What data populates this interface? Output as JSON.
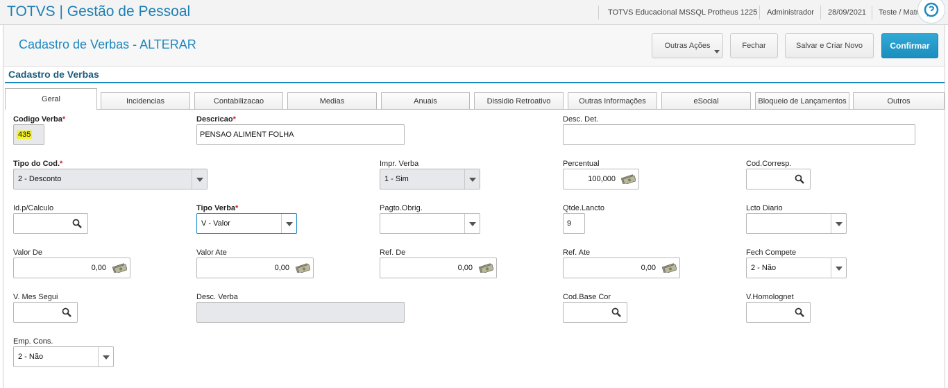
{
  "header": {
    "brand": "TOTVS | Gestão de Pessoal",
    "environment": "TOTVS Educacional MSSQL Protheus 1225",
    "user": "Administrador",
    "date": "28/09/2021",
    "branch": "Teste / Matr"
  },
  "page": {
    "title": "Cadastro de Verbas - ALTERAR",
    "section_title": "Cadastro de Verbas"
  },
  "toolbar": {
    "other_actions": "Outras Ações",
    "close": "Fechar",
    "save_new": "Salvar e Criar Novo",
    "confirm": "Confirmar"
  },
  "tabs": [
    {
      "label": "Geral"
    },
    {
      "label": "Incidencias"
    },
    {
      "label": "Contabilizacao"
    },
    {
      "label": "Medias"
    },
    {
      "label": "Anuais"
    },
    {
      "label": "Dissidio Retroativo"
    },
    {
      "label": "Outras Informações"
    },
    {
      "label": "eSocial"
    },
    {
      "label": "Bloqueio de Lançamentos"
    },
    {
      "label": "Outros"
    }
  ],
  "form": {
    "codigo_verba": {
      "label": "Codigo Verba",
      "required": "*",
      "value": "435"
    },
    "descricao": {
      "label": "Descricao",
      "required": "*",
      "value": "PENSAO ALIMENT FOLHA"
    },
    "desc_det": {
      "label": "Desc. Det.",
      "value": ""
    },
    "tipo_cod": {
      "label": "Tipo do Cod.",
      "required": "*",
      "value": "2 - Desconto"
    },
    "impr_verba": {
      "label": "Impr. Verba",
      "value": "1 - Sim"
    },
    "percentual": {
      "label": "Percentual",
      "value": "100,000"
    },
    "cod_corresp": {
      "label": "Cod.Corresp.",
      "value": ""
    },
    "id_calculo": {
      "label": "Id.p/Calculo",
      "value": ""
    },
    "tipo_verba": {
      "label": "Tipo Verba",
      "required": "*",
      "value": "V - Valor"
    },
    "pagto_obrig": {
      "label": "Pagto.Obrig.",
      "value": ""
    },
    "qtde_lancto": {
      "label": "Qtde.Lancto",
      "value": "9"
    },
    "lcto_diario": {
      "label": "Lcto Diario",
      "value": ""
    },
    "valor_de": {
      "label": "Valor De",
      "value": "0,00"
    },
    "valor_ate": {
      "label": "Valor Ate",
      "value": "0,00"
    },
    "ref_de": {
      "label": "Ref. De",
      "value": "0,00"
    },
    "ref_ate": {
      "label": "Ref. Ate",
      "value": "0,00"
    },
    "fech_compete": {
      "label": "Fech Compete",
      "value": "2 - Não"
    },
    "v_mes_segui": {
      "label": "V. Mes Segui",
      "value": ""
    },
    "desc_verba": {
      "label": "Desc. Verba",
      "value": ""
    },
    "cod_base_cor": {
      "label": "Cod.Base Cor",
      "value": ""
    },
    "v_homolognet": {
      "label": "V.Homolognet",
      "value": ""
    },
    "emp_cons": {
      "label": "Emp. Cons.",
      "value": "2 - Não"
    }
  },
  "colors": {
    "brand": "#1d7fb3",
    "title": "#1d87c0",
    "section": "#1c5c7c",
    "confirm_bg": "#1b8fbd",
    "required": "#d0202a",
    "highlight": "#f3f12a"
  }
}
